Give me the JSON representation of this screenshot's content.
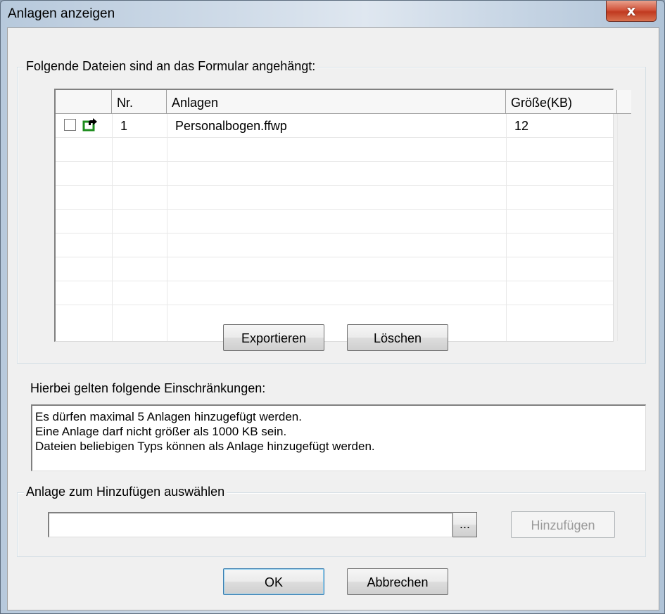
{
  "window": {
    "title": "Anlagen anzeigen",
    "close_label": "x"
  },
  "attachments_group": {
    "legend": "Folgende Dateien sind an das Formular angehängt:",
    "columns": [
      "",
      "Nr.",
      "Anlagen",
      "Größe(KB)"
    ],
    "rows": [
      {
        "checked": false,
        "icon": "export-arrow-icon",
        "nr": "1",
        "name": "Personalbogen.ffwp",
        "size": "12"
      }
    ],
    "export_label": "Exportieren",
    "delete_label": "Löschen"
  },
  "restrictions": {
    "heading": "Hierbei gelten folgende Einschränkungen:",
    "lines": [
      "Es dürfen maximal 5 Anlagen hinzugefügt werden.",
      "Eine Anlage darf nicht größer als 1000 KB sein.",
      "Dateien beliebigen Typs können als Anlage hinzugefügt werden."
    ]
  },
  "add_group": {
    "legend": "Anlage zum Hinzufügen auswählen",
    "file_value": "",
    "browse_label": "...",
    "add_label": "Hinzufügen"
  },
  "footer": {
    "ok_label": "OK",
    "cancel_label": "Abbrechen"
  },
  "colors": {
    "icon_green": "#1d8c1d",
    "close_red": "#c9472d"
  }
}
